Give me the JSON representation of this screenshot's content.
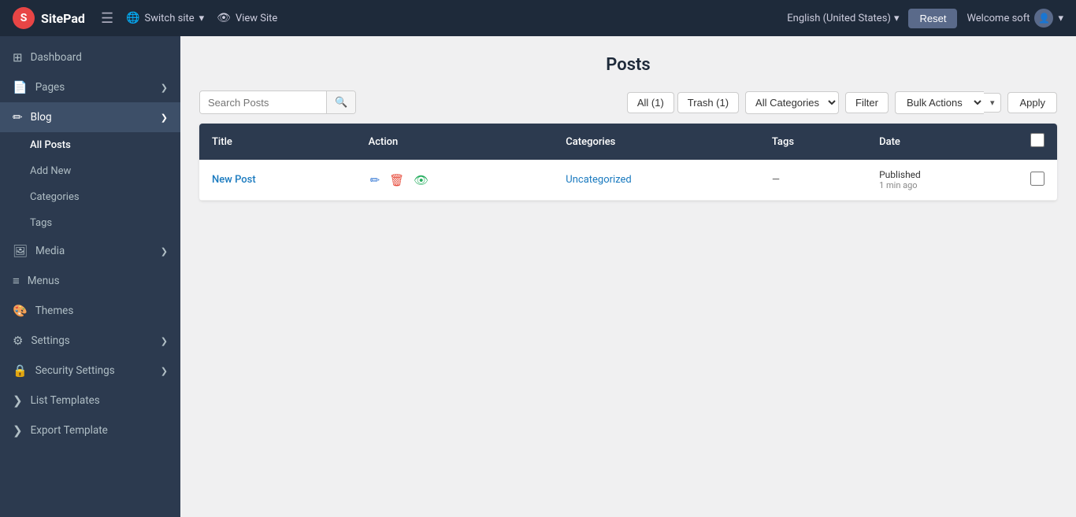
{
  "app": {
    "name": "SitePad",
    "logo_letter": "S"
  },
  "topnav": {
    "hamburger_icon": "☰",
    "switch_site_label": "Switch site",
    "view_site_label": "View Site",
    "language": "English (United States)",
    "reset_label": "Reset",
    "welcome_label": "Welcome soft",
    "globe_icon": "🌐",
    "eye_icon": "👁",
    "chevron_down": "▾",
    "user_icon": "👤"
  },
  "sidebar": {
    "items": [
      {
        "id": "dashboard",
        "label": "Dashboard",
        "icon": "⊞",
        "has_children": false
      },
      {
        "id": "pages",
        "label": "Pages",
        "icon": "📄",
        "has_children": true
      },
      {
        "id": "blog",
        "label": "Blog",
        "icon": "✏️",
        "has_children": true
      },
      {
        "id": "media",
        "label": "Media",
        "icon": "🖼",
        "has_children": true
      },
      {
        "id": "menus",
        "label": "Menus",
        "icon": "☰",
        "has_children": false
      },
      {
        "id": "themes",
        "label": "Themes",
        "icon": "🎨",
        "has_children": false
      },
      {
        "id": "settings",
        "label": "Settings",
        "icon": "⚙️",
        "has_children": true
      },
      {
        "id": "security",
        "label": "Security Settings",
        "icon": "🔒",
        "has_children": true
      },
      {
        "id": "list-templates",
        "label": "List Templates",
        "icon": "❯",
        "has_children": false
      },
      {
        "id": "export-template",
        "label": "Export Template",
        "icon": "❯",
        "has_children": false
      }
    ],
    "sub_items": [
      {
        "id": "all-posts",
        "label": "All Posts",
        "active": true
      },
      {
        "id": "add-new",
        "label": "Add New"
      },
      {
        "id": "categories",
        "label": "Categories"
      },
      {
        "id": "tags",
        "label": "Tags"
      }
    ]
  },
  "main": {
    "page_title": "Posts",
    "toolbar": {
      "search_placeholder": "Search Posts",
      "search_icon": "🔍",
      "tab_all": "All (1)",
      "tab_trash": "Trash (1)",
      "categories_default": "All Categories",
      "filter_label": "Filter",
      "bulk_actions_label": "Bulk Actions",
      "apply_label": "Apply"
    },
    "table": {
      "columns": [
        "Title",
        "Action",
        "Categories",
        "Tags",
        "Date"
      ],
      "rows": [
        {
          "title": "New Post",
          "category": "Uncategorized",
          "tags": "—",
          "date_status": "Published",
          "date_relative": "1 min ago"
        }
      ]
    }
  }
}
